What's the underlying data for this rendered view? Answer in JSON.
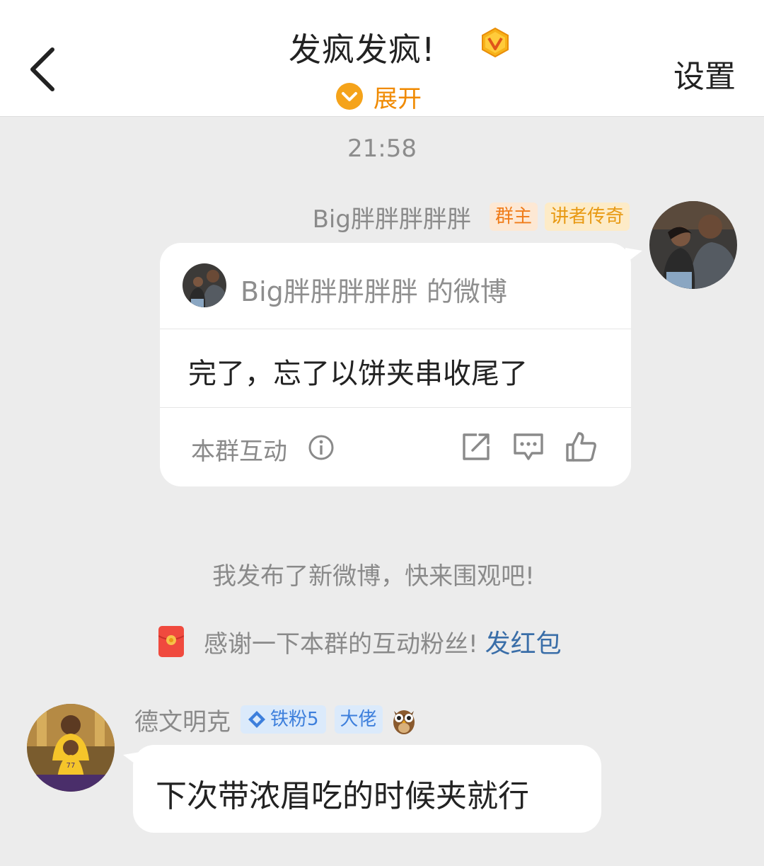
{
  "header": {
    "title": "发疯发疯!",
    "expand_label": "展开",
    "settings_label": "设置"
  },
  "chat": {
    "timestamp": "21:58",
    "self_message": {
      "sender": "Big胖胖胖胖胖",
      "tags": [
        "群主",
        "讲者传奇"
      ],
      "card": {
        "source": "Big胖胖胖胖胖 的微博",
        "text": "完了，忘了以饼夹串收尾了",
        "interact_label": "本群互动"
      }
    },
    "system_message": "我发布了新微博，快来围观吧!",
    "redpack": {
      "text": "感谢一下本群的互动粉丝!",
      "link": "发红包"
    },
    "other_message": {
      "sender": "德文明克",
      "fan_badge": "铁粉5",
      "role_badge": "大佬",
      "text": "下次带浓眉吃的时候夹就行"
    }
  },
  "colors": {
    "accent_orange": "#f08a00",
    "link_blue": "#3a6ea8",
    "background": "#ececec"
  },
  "icons": [
    "back-arrow-icon",
    "vip-badge-icon",
    "chevron-down-icon",
    "info-icon",
    "share-icon",
    "comment-icon",
    "like-icon",
    "red-envelope-icon",
    "fan-diamond-icon",
    "owl-icon"
  ]
}
